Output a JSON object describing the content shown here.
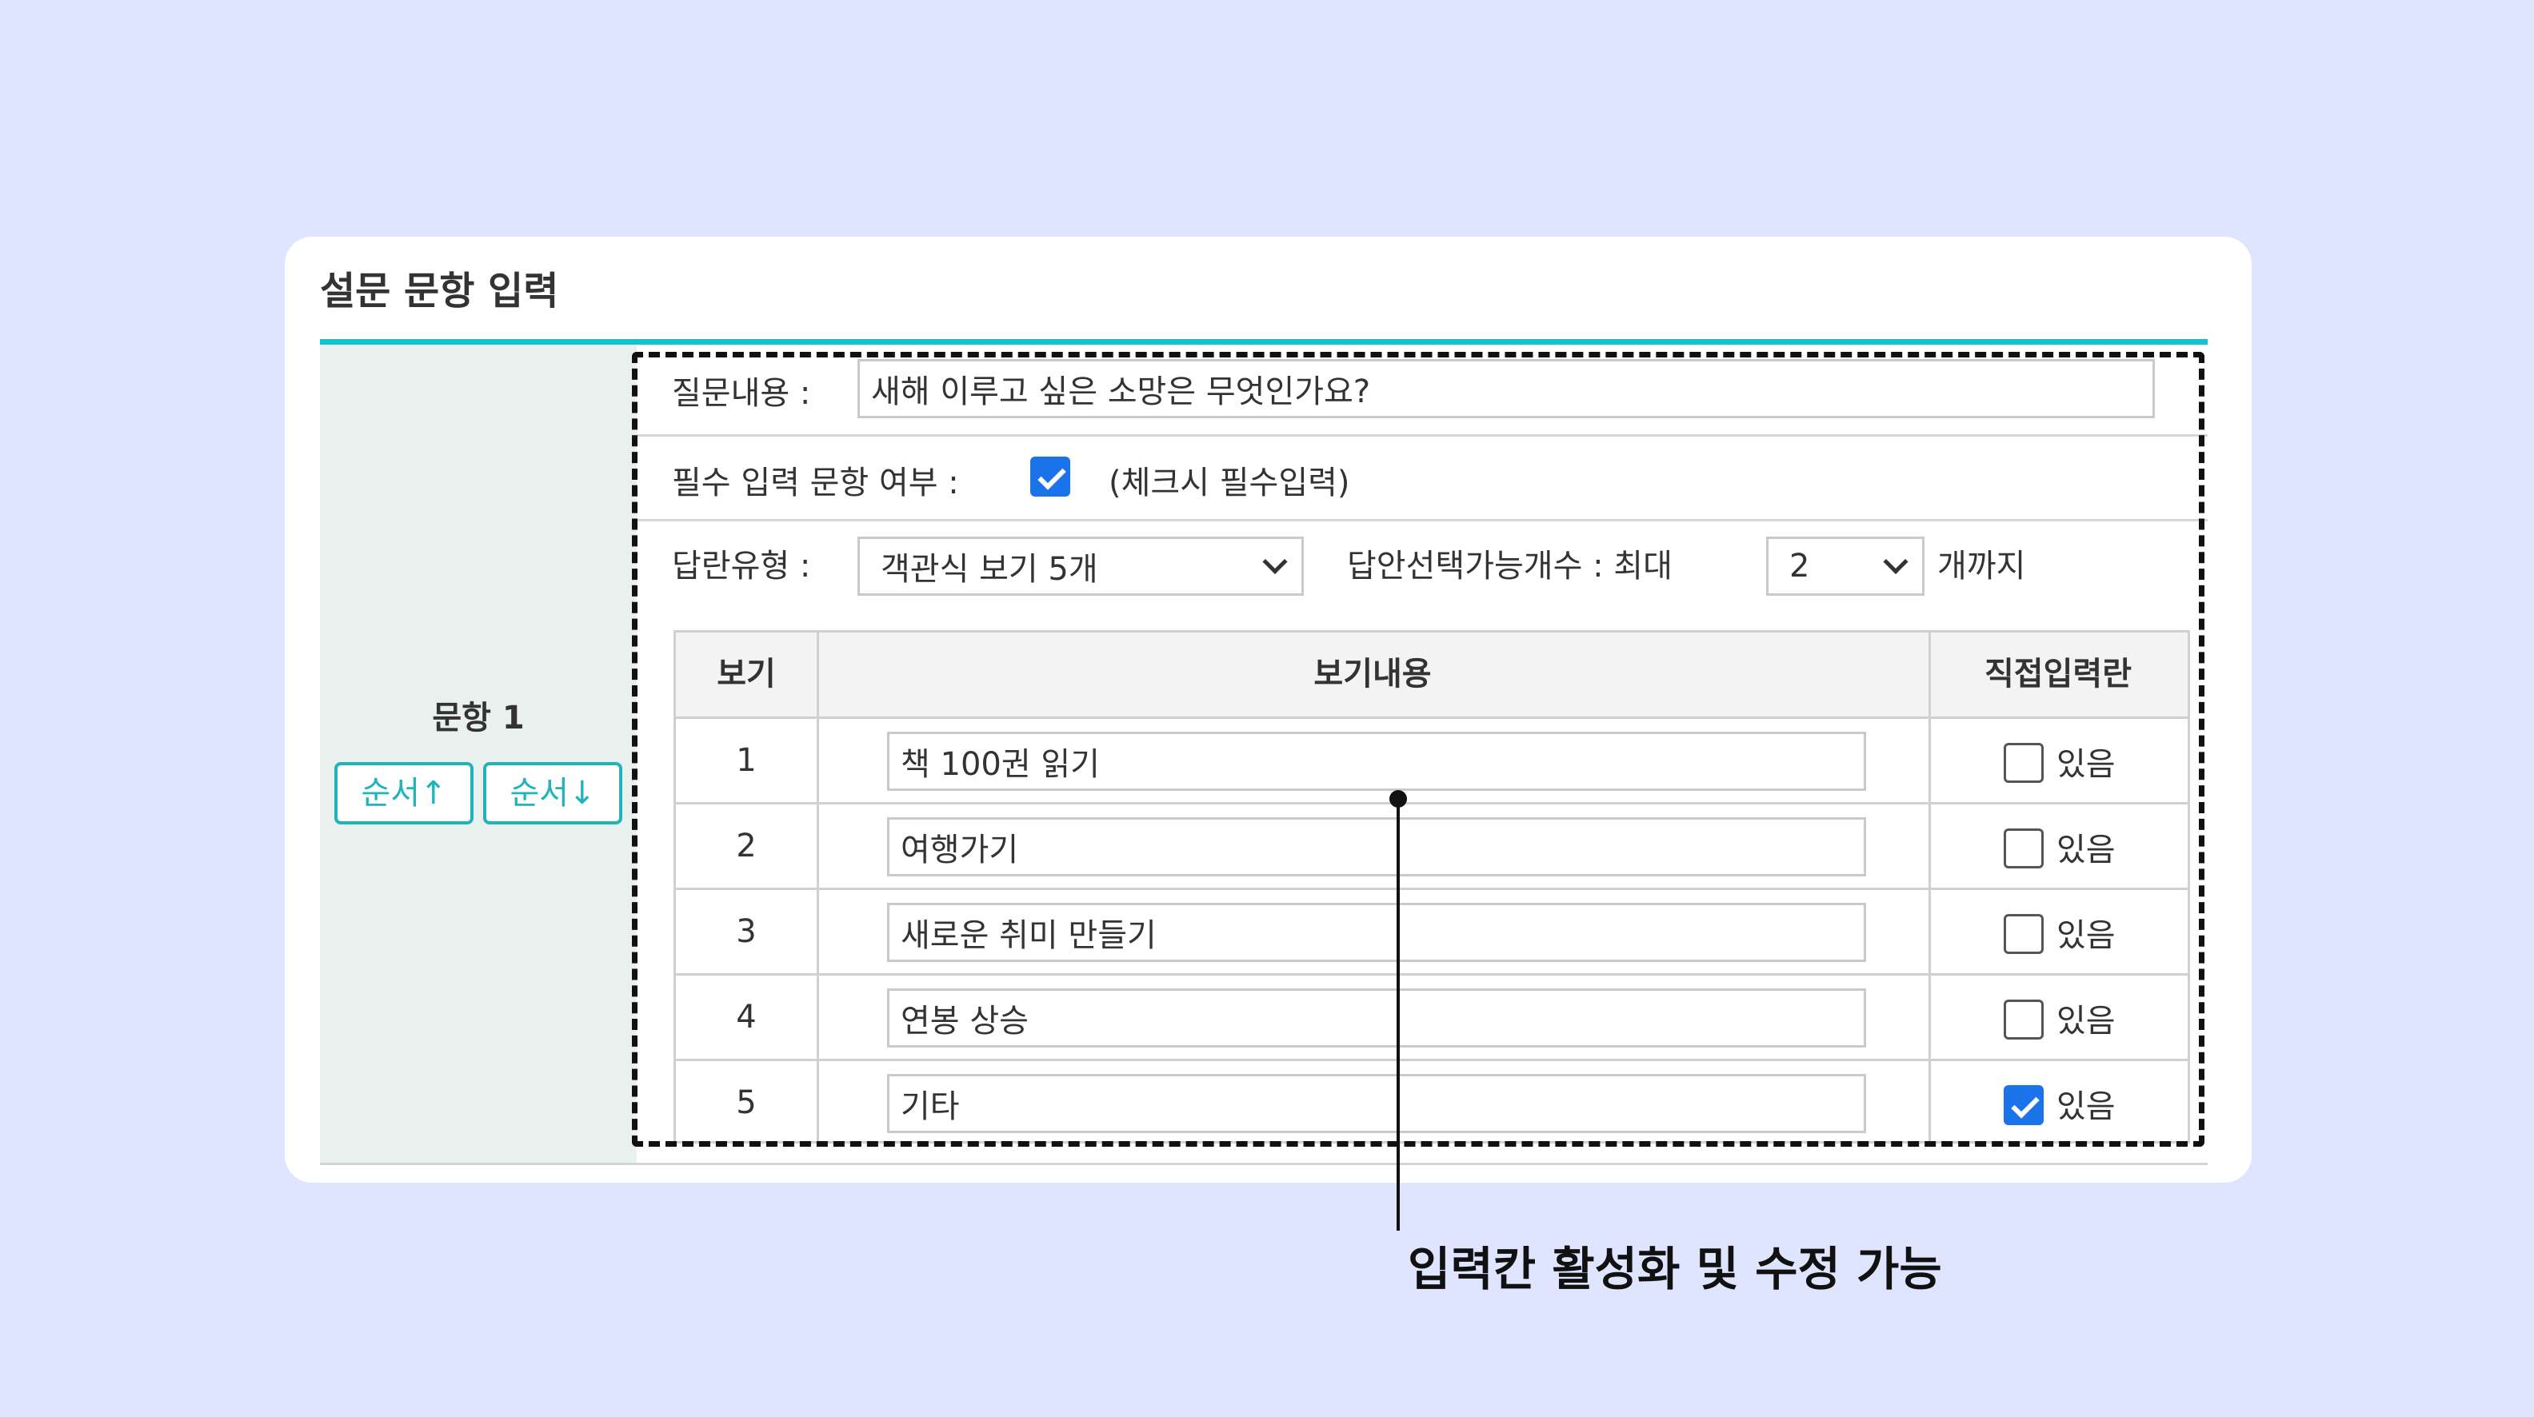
{
  "section_title": "설문 문항 입력",
  "question_block": {
    "label": "문항 1",
    "order_up_label": "순서↑",
    "order_down_label": "순서↓"
  },
  "question": {
    "label": "질문내용 :",
    "value": "새해 이루고 싶은 소망은 무엇인가요?"
  },
  "required": {
    "label": "필수 입력 문항 여부 :",
    "checked": true,
    "hint": "(체크시 필수입력)"
  },
  "answer_type": {
    "label": "답란유형 :",
    "selected": "객관식 보기 5개",
    "max_label": "답안선택가능개수 :  최대",
    "max_selected": "2",
    "suffix": "개까지"
  },
  "options_table": {
    "headers": {
      "num": "보기",
      "content": "보기내용",
      "direct": "직접입력란"
    },
    "direct_label": "있음",
    "rows": [
      {
        "num": "1",
        "content": "책 100권 읽기",
        "direct": false
      },
      {
        "num": "2",
        "content": "여행가기",
        "direct": false
      },
      {
        "num": "3",
        "content": "새로운 취미 만들기",
        "direct": false
      },
      {
        "num": "4",
        "content": "연봉 상승",
        "direct": false
      },
      {
        "num": "5",
        "content": "기타",
        "direct": true
      }
    ]
  },
  "annotation": "입력칸 활성화 및 수정 가능",
  "colors": {
    "background": "#dfe5fe",
    "accent": "#11c3cc",
    "button": "#20b3bb",
    "checkbox": "#1a73e8",
    "left_column": "#e9f1ee"
  }
}
